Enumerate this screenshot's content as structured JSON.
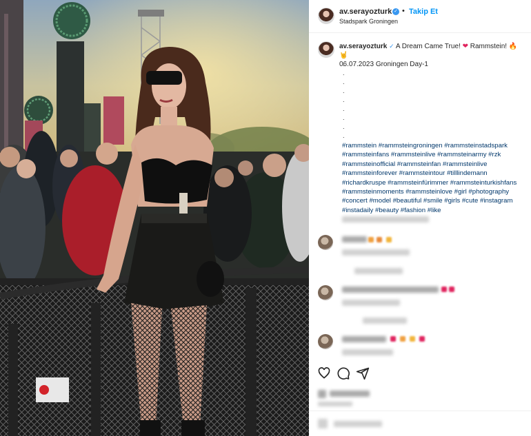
{
  "post": {
    "username": "av.serayozturk",
    "follow_label": "Takip Et",
    "dot_separator": "•",
    "location": "Stadspark Groningen",
    "caption_text": "A Dream Came True!",
    "caption_band": "Rammstein!",
    "caption_date_line": "06.07.2023 Groningen Day-1",
    "caption_dots": [
      ".",
      ".",
      ".",
      ".",
      ".",
      ".",
      ".",
      ".",
      "."
    ],
    "hashtag_lines": [
      "#rammstein #rammsteingroningen #rammsteinstadspark",
      "#rammsteinfans #rammsteinlive #rammsteinarmy #rzk",
      "#rammsteinofficial #rammsteinfan #rammsteinlive",
      "#rammsteinforever #rammsteintour #tilllindemann",
      "#richardkruspe #rammsteinfürimmer #rammsteinturkishfans",
      "#rammsteinmoments #rammsteinlove #girl #photography",
      "#concert #model #beautiful #smile #girls #cute #instagram",
      "#instadaily #beauty #fashion #like"
    ],
    "caption_emojis": {
      "heart": "❤",
      "fire": "🔥",
      "hands": "🤘"
    },
    "verified_mark": "✓"
  },
  "icons": {
    "heart": "heart-icon",
    "comment": "comment-icon",
    "share": "share-icon"
  },
  "colors": {
    "accent": "#0095f6",
    "verified": "#3897f0",
    "hashtag": "#00376b",
    "heart": "#e0245e"
  }
}
